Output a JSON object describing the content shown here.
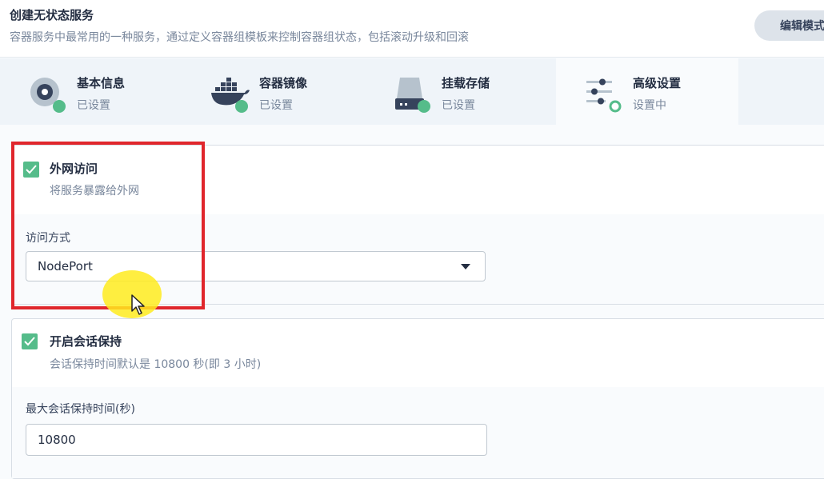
{
  "header": {
    "title": "创建无状态服务",
    "description": "容器服务中最常用的一种服务，通过定义容器组模板来控制容器组状态，包括滚动升级和回滚",
    "edit_mode_button": "编辑模式"
  },
  "steps": [
    {
      "title": "基本信息",
      "status": "已设置",
      "icon": "disk-icon"
    },
    {
      "title": "容器镜像",
      "status": "已设置",
      "icon": "docker-whale-icon"
    },
    {
      "title": "挂载存储",
      "status": "已设置",
      "icon": "storage-drive-icon"
    },
    {
      "title": "高级设置",
      "status": "设置中",
      "icon": "sliders-icon"
    }
  ],
  "external_access": {
    "title": "外网访问",
    "description": "将服务暴露给外网",
    "checked": true,
    "access_method_label": "访问方式",
    "access_method_value": "NodePort"
  },
  "session_affinity": {
    "title": "开启会话保持",
    "description": "会话保持时间默认是 10800 秒(即 3 小时)",
    "checked": true,
    "max_time_label": "最大会话保持时间(秒)",
    "max_time_value": "10800"
  },
  "colors": {
    "accent_green": "#55bc8a",
    "highlight_red": "#e0262c",
    "cursor_highlight": "#ffeb1e"
  }
}
